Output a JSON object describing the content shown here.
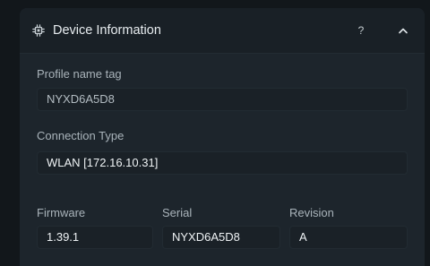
{
  "panel": {
    "title": "Device Information",
    "help_label": "?"
  },
  "profile": {
    "label": "Profile name tag",
    "value": "NYXD6A5D8"
  },
  "connection": {
    "label": "Connection Type",
    "value": "WLAN [172.16.10.31]"
  },
  "firmware": {
    "label": "Firmware",
    "value": "1.39.1"
  },
  "serial": {
    "label": "Serial",
    "value": "NYXD6A5D8"
  },
  "revision": {
    "label": "Revision",
    "value": "A"
  }
}
